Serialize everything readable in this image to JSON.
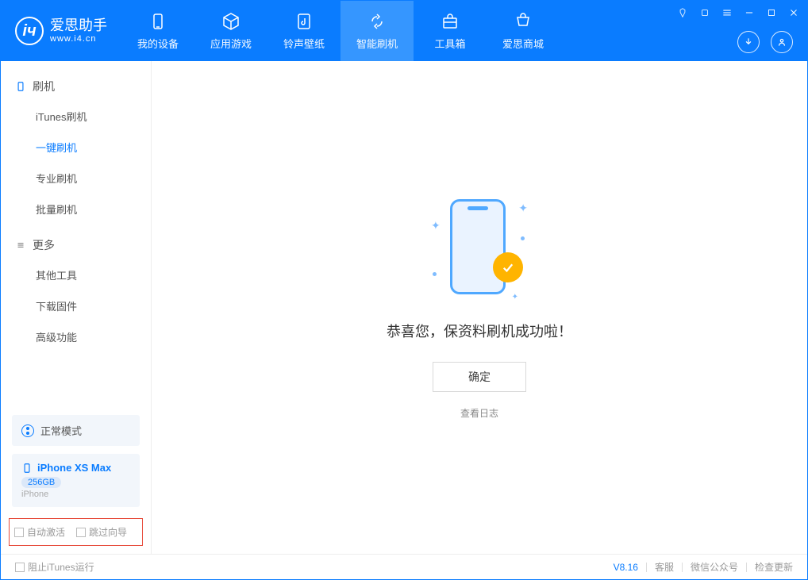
{
  "colors": {
    "primary": "#0a7cff",
    "accent": "#ffb400"
  },
  "header": {
    "logo_main": "爱思助手",
    "logo_sub": "www.i4.cn",
    "tabs": [
      {
        "label": "我的设备",
        "icon": "device"
      },
      {
        "label": "应用游戏",
        "icon": "cube"
      },
      {
        "label": "铃声壁纸",
        "icon": "music"
      },
      {
        "label": "智能刷机",
        "icon": "refresh",
        "active": true
      },
      {
        "label": "工具箱",
        "icon": "toolbox"
      },
      {
        "label": "爱思商城",
        "icon": "cart"
      }
    ]
  },
  "titlebar_icons": [
    "tshirt",
    "plugin",
    "menu",
    "minimize",
    "maximize",
    "close"
  ],
  "header_right_icons": [
    "download",
    "user"
  ],
  "sidebar": {
    "section1": {
      "title": "刷机",
      "items": [
        "iTunes刷机",
        "一键刷机",
        "专业刷机",
        "批量刷机"
      ],
      "active_index": 1
    },
    "section2": {
      "title": "更多",
      "items": [
        "其他工具",
        "下载固件",
        "高级功能"
      ]
    },
    "mode_label": "正常模式",
    "device": {
      "name": "iPhone XS Max",
      "storage": "256GB",
      "type": "iPhone"
    },
    "bottom_checks": [
      "自动激活",
      "跳过向导"
    ]
  },
  "main": {
    "success_text": "恭喜您，保资料刷机成功啦！",
    "ok_button": "确定",
    "log_link": "查看日志"
  },
  "footer": {
    "itunes_check": "阻止iTunes运行",
    "version": "V8.16",
    "links": [
      "客服",
      "微信公众号",
      "检查更新"
    ]
  }
}
